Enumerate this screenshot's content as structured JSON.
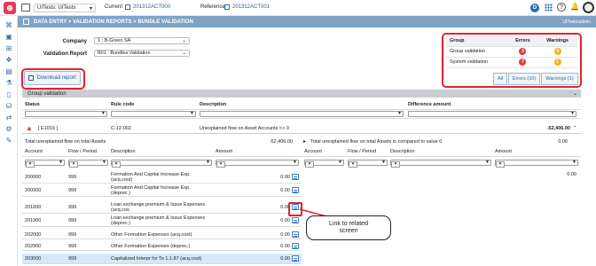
{
  "topbar": {
    "logo": "⊕",
    "nav_sel": "UITests: UITests",
    "current_label": "Current",
    "current_val": "201312ACT000",
    "ref_label": "Reference",
    "ref_val": "201312ACT001",
    "user_badge": "D"
  },
  "breadcrumb": "DATA ENTRY > VALIDATION REPORTS > BUNDLE VALIDATION",
  "breadcrumb_right": "UITests\\admin",
  "form": {
    "company_label": "Company",
    "company_val": "1 : B-Green SA",
    "report_label": "Validation Report",
    "report_val": "B01 : Bundles Validation"
  },
  "download_label": "Download report",
  "summary": {
    "headers": [
      "Group",
      "Errors",
      "Warnings"
    ],
    "rows": [
      {
        "group": "Group validation",
        "errors": "3",
        "warnings": "0"
      },
      {
        "group": "System validation",
        "errors": "7",
        "warnings": "1"
      }
    ],
    "tabs": [
      "All",
      "Errors (10)",
      "Warnings (1)"
    ],
    "colors": {
      "error": "#e03a3a",
      "warning": "#f2b21b"
    }
  },
  "section_title": "Group validation",
  "main_headers": [
    "Status",
    "Rule code",
    "Description",
    "Difference amount"
  ],
  "error_row": {
    "status": "[ E1019 ]",
    "rule": "C-12-002",
    "desc": "Unexplained flow on Asset Accounts <> 0",
    "amount": "-52,406.00"
  },
  "left_panel": {
    "title": "Total unexplained flow on total Assets",
    "total": "-52,406.00",
    "headers": [
      "Account",
      "Flow / Period",
      "Description",
      "Amount"
    ],
    "rows": [
      {
        "acct": "200000",
        "flow": "999",
        "desc1": "Formation And Capital Increase Exp.",
        "desc2": "(acq.cost)",
        "amt": "0.00"
      },
      {
        "acct": "200900",
        "flow": "999",
        "desc1": "Formation And Capital Increase Exp.",
        "desc2": "(deprec.)",
        "amt": "0.00"
      },
      {
        "acct": "201000",
        "flow": "999",
        "desc1": "Loan exchange premium & Issue Expenses",
        "desc2": "(acq.cos",
        "amt": "0.00"
      },
      {
        "acct": "201900",
        "flow": "999",
        "desc1": "Loan exchange premium & Issue Expenses",
        "desc2": "(deprec.)",
        "amt": "0.00"
      },
      {
        "acct": "202000",
        "flow": "999",
        "desc1": "Other Formation Expenses (acq.cost)",
        "desc2": "",
        "amt": "0.00"
      },
      {
        "acct": "202900",
        "flow": "999",
        "desc1": "Other Formation Expenses (deprec.)",
        "desc2": "",
        "amt": "0.00"
      },
      {
        "acct": "203000",
        "flow": "999",
        "desc1": "Capitalized Interpr for To 1.1.87 (acq.cost)",
        "desc2": "",
        "amt": "0.00"
      }
    ]
  },
  "right_panel": {
    "title": "Total unexplained flow on total Assets is compared to value 0",
    "total": "0.00",
    "headers": [
      "Account",
      "Flow / Period",
      "Description",
      "Amount"
    ],
    "first_amount": "0.00"
  },
  "callout": {
    "line1": "Link to related",
    "line2": "screen"
  }
}
